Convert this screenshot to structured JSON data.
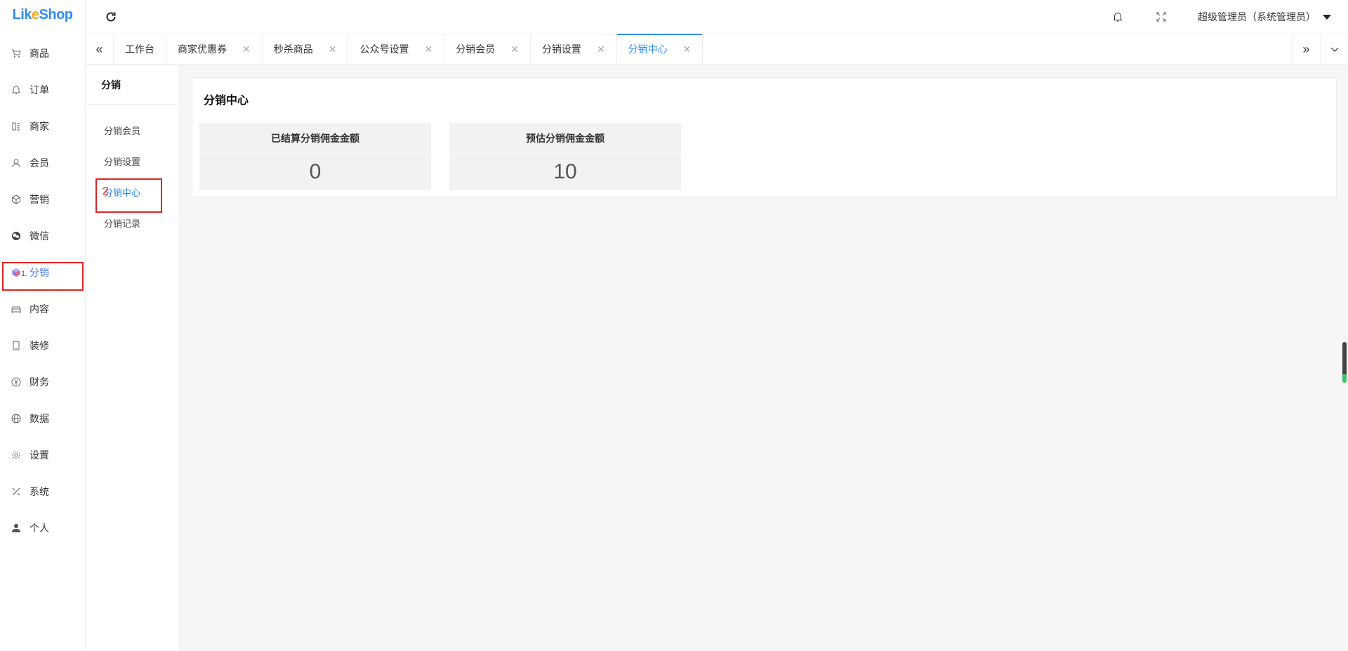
{
  "app": {
    "logo_part1": "Lik",
    "logo_part2": "e",
    "logo_part3": "Shop"
  },
  "sidebar": {
    "items": [
      {
        "label": "商品",
        "icon": "cart-icon"
      },
      {
        "label": "订单",
        "icon": "bell-icon"
      },
      {
        "label": "商家",
        "icon": "store-icon"
      },
      {
        "label": "会员",
        "icon": "user-icon"
      },
      {
        "label": "营销",
        "icon": "box-icon"
      },
      {
        "label": "微信",
        "icon": "wechat-icon"
      },
      {
        "label": "分销",
        "icon": "cube-icon",
        "active": true
      },
      {
        "label": "内容",
        "icon": "sofa-icon"
      },
      {
        "label": "装修",
        "icon": "tablet-icon"
      },
      {
        "label": "财务",
        "icon": "yen-icon"
      },
      {
        "label": "数据",
        "icon": "globe-icon"
      },
      {
        "label": "设置",
        "icon": "gear-icon"
      },
      {
        "label": "系统",
        "icon": "tools-icon"
      },
      {
        "label": "个人",
        "icon": "person-icon"
      }
    ],
    "annotation": "1."
  },
  "header": {
    "user_label": "超级管理员（系统管理员）"
  },
  "tabs": [
    {
      "label": "工作台",
      "closable": false
    },
    {
      "label": "商家优惠券",
      "closable": true
    },
    {
      "label": "秒杀商品",
      "closable": true
    },
    {
      "label": "公众号设置",
      "closable": true
    },
    {
      "label": "分销会员",
      "closable": true
    },
    {
      "label": "分销设置",
      "closable": true
    },
    {
      "label": "分销中心",
      "closable": true,
      "active": true
    }
  ],
  "subsidebar": {
    "title": "分销",
    "items": [
      {
        "label": "分销会员"
      },
      {
        "label": "分销设置"
      },
      {
        "label": "分销中心",
        "active": true
      },
      {
        "label": "分销记录"
      }
    ],
    "annotation": "2."
  },
  "main": {
    "title": "分销中心",
    "stats": [
      {
        "label": "已结算分销佣金金额",
        "value": "0"
      },
      {
        "label": "预估分销佣金金额",
        "value": "10"
      }
    ]
  },
  "colors": {
    "accent": "#2d8cf0",
    "highlight_box": "#e02424",
    "page_bg": "#f6f6f6"
  }
}
